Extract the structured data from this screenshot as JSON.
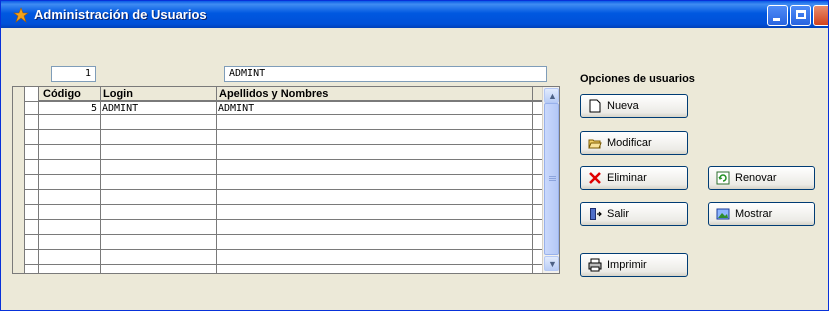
{
  "window": {
    "title": "Administración de Usuarios"
  },
  "top_fields": {
    "count_value": "1",
    "name_value": "ADMINT"
  },
  "grid": {
    "columns": [
      "Código",
      "Login",
      "Apellidos y Nombres"
    ],
    "rows": [
      {
        "codigo": "5",
        "login": "ADMINT",
        "nombres": "ADMINT"
      }
    ]
  },
  "options": {
    "label": "Opciones de usuarios",
    "nueva": "Nueva",
    "modificar": "Modificar",
    "eliminar": "Eliminar",
    "renovar": "Renovar",
    "salir": "Salir",
    "mostrar": "Mostrar",
    "imprimir": "Imprimir"
  },
  "colors": {
    "titlebar": "#0058e0",
    "face": "#ece9d8",
    "accent_red": "#e00000"
  }
}
